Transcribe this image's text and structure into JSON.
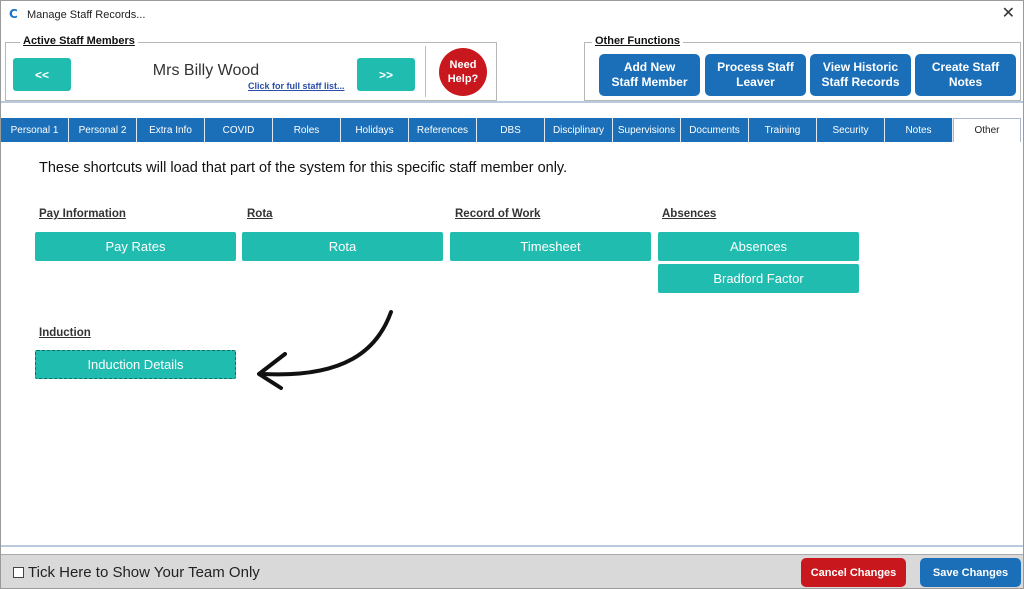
{
  "window": {
    "title": "Manage Staff Records...",
    "app_icon": "c-logo-icon",
    "close_glyph": "✕"
  },
  "staff": {
    "group_label": "Active Staff Members",
    "prev_label": "<<",
    "next_label": ">>",
    "name": "Mrs Billy Wood",
    "full_list_link": "Click for full staff list...",
    "help_label": "Need\nHelp?"
  },
  "other_functions": {
    "group_label": "Other Functions",
    "buttons": [
      "Add New\nStaff Member",
      "Process Staff\nLeaver",
      "View Historic\nStaff Records",
      "Create Staff\nNotes"
    ]
  },
  "tabs": [
    "Personal 1",
    "Personal 2",
    "Extra Info",
    "COVID",
    "Roles",
    "Holidays",
    "References",
    "DBS",
    "Disciplinary",
    "Supervisions",
    "Documents",
    "Training",
    "Security",
    "Notes",
    "Other"
  ],
  "active_tab": "Other",
  "content": {
    "intro": "These shortcuts will load that part of the system for this specific staff member only.",
    "sections": {
      "pay": {
        "label": "Pay Information",
        "buttons": [
          "Pay Rates"
        ]
      },
      "rota": {
        "label": "Rota",
        "buttons": [
          "Rota"
        ]
      },
      "work": {
        "label": "Record of Work",
        "buttons": [
          "Timesheet"
        ]
      },
      "absences": {
        "label": "Absences",
        "buttons": [
          "Absences",
          "Bradford Factor"
        ]
      },
      "induction": {
        "label": "Induction",
        "buttons": [
          "Induction Details"
        ]
      }
    },
    "annotation_icon": "curved-arrow-icon"
  },
  "footer": {
    "team_only_label": "Tick Here to Show Your Team Only",
    "team_only_checked": false,
    "cancel_label": "Cancel Changes",
    "save_label": "Save Changes"
  },
  "colors": {
    "teal": "#20bcb0",
    "blue": "#1b6fb8",
    "red": "#c8181e"
  }
}
